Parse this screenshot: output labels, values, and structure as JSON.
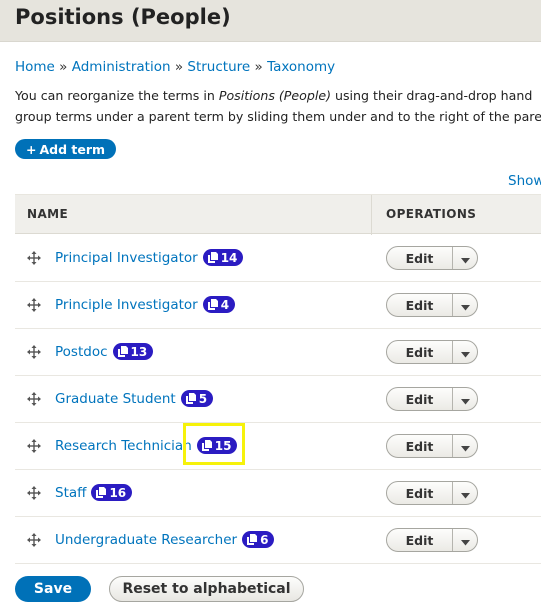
{
  "header": {
    "title": "Positions (People)"
  },
  "breadcrumb": {
    "items": [
      "Home",
      "Administration",
      "Structure",
      "Taxonomy"
    ],
    "separator": "»"
  },
  "help": {
    "line1_prefix": "You can reorganize the terms in ",
    "line1_vocab": "Positions (People)",
    "line1_suffix": " using their drag-and-drop hand",
    "line2": "group terms under a parent term by sliding them under and to the right of the pare"
  },
  "actions": {
    "add_term_icon": "+",
    "add_term_label": "Add term"
  },
  "table": {
    "show_link": "Show",
    "columns": {
      "name": "NAME",
      "operations": "OPERATIONS"
    },
    "rows": [
      {
        "name": "Principal Investigator",
        "count": "14",
        "edit_label": "Edit"
      },
      {
        "name": "Principle Investigator",
        "count": "4",
        "edit_label": "Edit"
      },
      {
        "name": "Postdoc",
        "count": "13",
        "edit_label": "Edit"
      },
      {
        "name": "Graduate Student",
        "count": "5",
        "edit_label": "Edit"
      },
      {
        "name": "Research Technician",
        "count": "15",
        "edit_label": "Edit",
        "highlighted": true
      },
      {
        "name": "Staff",
        "count": "16",
        "edit_label": "Edit"
      },
      {
        "name": "Undergraduate Researcher",
        "count": "6",
        "edit_label": "Edit"
      }
    ]
  },
  "footer": {
    "save_label": "Save",
    "reset_label": "Reset to alphabetical"
  },
  "colors": {
    "link": "#0074bd",
    "primary_button": "#0071b8",
    "badge": "#2b1cc2",
    "highlight": "#f6f20a",
    "header_bg": "#e6e4dd"
  },
  "icons": {
    "drag": "drag-handle-icon",
    "badge": "document-copy-icon",
    "toggle": "caret-down-icon"
  }
}
